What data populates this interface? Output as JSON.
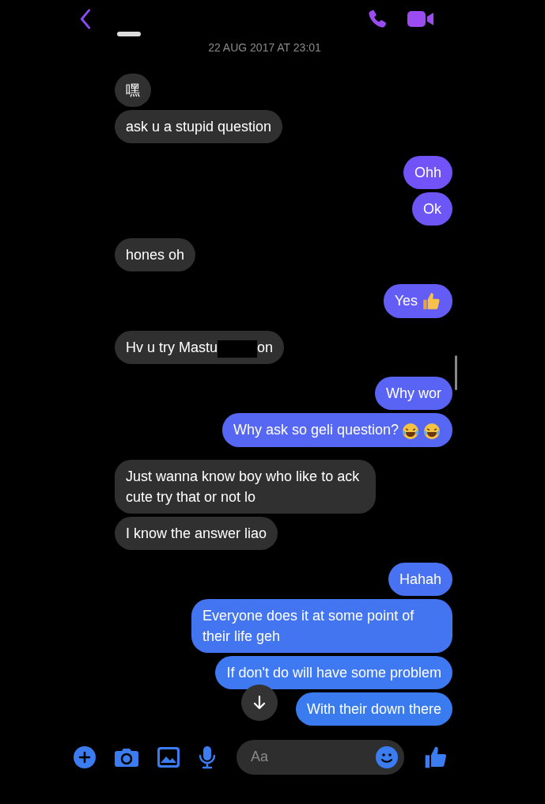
{
  "header": {
    "name_hidden": true
  },
  "timestamp": "22 AUG 2017 AT 23:01",
  "messages": [
    {
      "kind": "incoming",
      "parts": [
        {
          "kind": "text",
          "text": "嘿"
        }
      ]
    },
    {
      "kind": "incoming",
      "parts": [
        {
          "kind": "text",
          "text": "ask u a stupid question"
        }
      ]
    },
    {
      "kind": "outgoing",
      "parts": [
        {
          "kind": "text",
          "text": "Ohh"
        }
      ]
    },
    {
      "kind": "outgoing",
      "parts": [
        {
          "kind": "text",
          "text": "Ok"
        }
      ]
    },
    {
      "kind": "incoming",
      "parts": [
        {
          "kind": "text",
          "text": "hones oh"
        }
      ]
    },
    {
      "kind": "outgoing",
      "parts": [
        {
          "kind": "text",
          "text": "Yes"
        },
        {
          "kind": "thumbs_up"
        }
      ]
    },
    {
      "kind": "incoming",
      "parts": [
        {
          "kind": "text",
          "text": "Hv u try Mastu"
        },
        {
          "kind": "redaction"
        },
        {
          "kind": "text",
          "text": "on"
        }
      ]
    },
    {
      "kind": "outgoing",
      "parts": [
        {
          "kind": "text",
          "text": "Why wor"
        }
      ]
    },
    {
      "kind": "outgoing",
      "parts": [
        {
          "kind": "text",
          "text": "Why ask so geli question?"
        },
        {
          "kind": "laughing"
        },
        {
          "kind": "laughing"
        }
      ]
    },
    {
      "kind": "incoming",
      "parts": [
        {
          "kind": "text",
          "text": "Just wanna know boy who like to ack cute try that or not lo"
        }
      ]
    },
    {
      "kind": "incoming",
      "parts": [
        {
          "kind": "text",
          "text": "I know the answer liao"
        }
      ]
    },
    {
      "kind": "outgoing",
      "parts": [
        {
          "kind": "text",
          "text": "Hahah"
        }
      ]
    },
    {
      "kind": "outgoing",
      "parts": [
        {
          "kind": "text",
          "text": "Everyone does it at some point of their life geh"
        }
      ]
    },
    {
      "kind": "outgoing",
      "parts": [
        {
          "kind": "text",
          "text": "If don't do will have some problem"
        }
      ]
    },
    {
      "kind": "outgoing",
      "parts": [
        {
          "kind": "text",
          "text": "With their down there"
        }
      ]
    }
  ],
  "composer": {
    "placeholder": "Aa"
  }
}
